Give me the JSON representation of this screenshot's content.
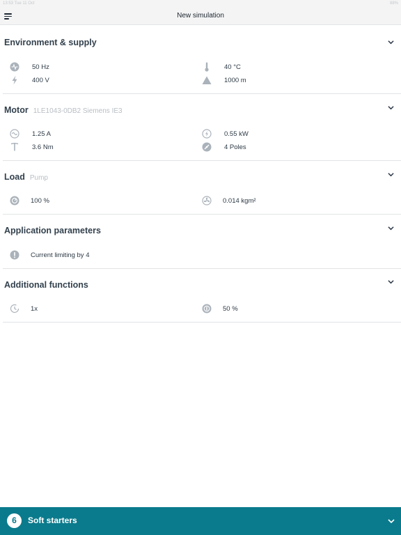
{
  "status_bar": {
    "left": "13:53  Tue 11 Oct",
    "right": "88%"
  },
  "navbar": {
    "title": "New simulation",
    "menu_icon": "hamburger-menu-icon"
  },
  "sections": {
    "environment": {
      "title": "Environment & supply",
      "items": {
        "frequency": {
          "value": "50 Hz",
          "icon": "waveform-icon"
        },
        "temperature": {
          "value": "40 °C",
          "icon": "thermometer-icon"
        },
        "voltage": {
          "value": "400 V",
          "icon": "lightning-icon"
        },
        "altitude": {
          "value": "1000 m",
          "icon": "mountain-icon"
        }
      }
    },
    "motor": {
      "title": "Motor",
      "subtitle": "1LE1043-0DB2 Siemens IE3",
      "items": {
        "current": {
          "value": "1.25 A",
          "icon": "ac-current-icon"
        },
        "power": {
          "value": "0.55 kW",
          "icon": "power-meter-icon"
        },
        "torque": {
          "value": "3.6 Nm",
          "icon": "torque-icon"
        },
        "poles": {
          "value": "4 Poles",
          "icon": "gauge-icon"
        }
      }
    },
    "load": {
      "title": "Load",
      "subtitle": "Pump",
      "items": {
        "load_factor": {
          "value": "100 %",
          "icon": "load-gauge-icon"
        },
        "inertia": {
          "value": "0.014 kgm²",
          "icon": "fan-icon"
        }
      }
    },
    "application": {
      "title": "Application parameters",
      "items": {
        "current_limiting": {
          "value": "Current limiting by 4",
          "icon": "info-icon"
        }
      }
    },
    "additional": {
      "title": "Additional functions",
      "items": {
        "starts": {
          "value": "1x",
          "icon": "clock-icon"
        },
        "duty": {
          "value": "50 %",
          "icon": "duty-cycle-icon"
        }
      }
    }
  },
  "bottom_bar": {
    "count": "6",
    "label": "Soft starters",
    "color": "#0a7b8c"
  },
  "colors": {
    "accent": "#0a7b8c",
    "icon": "#aab2ba",
    "text": "#2d3a45"
  }
}
